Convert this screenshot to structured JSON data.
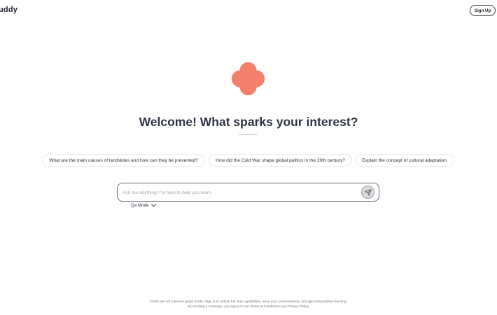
{
  "header": {
    "brand": "uddy",
    "signup_label": "Sign Up"
  },
  "logo": {
    "icon": "flower-blob-icon",
    "color": "#f47f6b"
  },
  "hero": {
    "title": "Welcome! What sparks your interest?"
  },
  "suggestions": [
    {
      "label": "What are the main causes of landslides and how can they be prevented?"
    },
    {
      "label": "How did the Cold War shape global politics in the 20th century?"
    },
    {
      "label": "Explain the concept of cultural adaptation."
    }
  ],
  "composer": {
    "placeholder": "Ask me anything! I'm here to help you learn.",
    "value": "",
    "send_icon": "send-icon",
    "mode_label": "Qa Mode",
    "mode_icon": "chevron-down-icon"
  },
  "footer": {
    "line1": "Chats are not saved in guest mode. Sign in to unlock full chat capabilities, save your conversations, and get personalized learning.",
    "line2": "By sending a message, you agree to our Terms & Conditions and Privacy Policy."
  }
}
